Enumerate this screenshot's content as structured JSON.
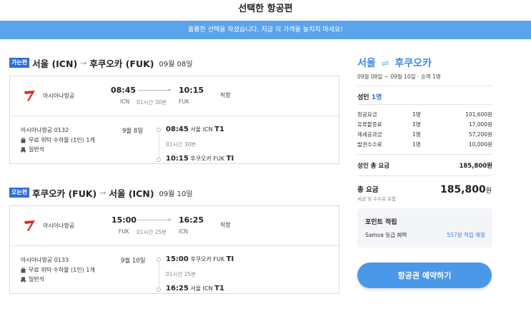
{
  "page_title": "선택한 항공편",
  "banner": "훌륭한 선택을 하셨습니다. 지금 이 가격을 놓치지 마세요!",
  "outbound": {
    "badge": "가는편",
    "from": "서울 (ICN)",
    "arrow": "→",
    "to": "후쿠오카 (FUK)",
    "date": "09월 08일",
    "airline": "아시아나항공",
    "dep_time": "08:45",
    "dep_code": "ICN",
    "arr_time": "10:15",
    "arr_code": "FUK",
    "duration": "01시간 30분",
    "stops": "직항",
    "flight_no": "아시아나항공 0132",
    "baggage": "무료 위탁 수하물 (1인) 1개",
    "cabin": "일반석",
    "day": "9월 8일",
    "dep_detail_time": "08:45",
    "dep_detail_place": "서울 ICN",
    "dep_terminal": "T1",
    "detail_duration": "01시간 30분",
    "arr_detail_time": "10:15",
    "arr_detail_place": "후쿠오카 FUK",
    "arr_terminal": "TI"
  },
  "inbound": {
    "badge": "오는편",
    "from": "후쿠오카 (FUK)",
    "arrow": "→",
    "to": "서울 (ICN)",
    "date": "09월 10일",
    "airline": "아시아나항공",
    "dep_time": "15:00",
    "dep_code": "FUK",
    "arr_time": "16:25",
    "arr_code": "ICN",
    "duration": "01시간 25분",
    "stops": "직항",
    "flight_no": "아시아나항공 0133",
    "baggage": "무료 위탁 수하물 (1인) 1개",
    "cabin": "일반석",
    "day": "9월 10일",
    "dep_detail_time": "15:00",
    "dep_detail_place": "후쿠오카 FUK",
    "dep_terminal": "TI",
    "detail_duration": "01시간 25분",
    "arr_detail_time": "16:25",
    "arr_detail_place": "서울 ICN",
    "arr_terminal": "T1"
  },
  "summary": {
    "from": "서울",
    "swap": "⇌",
    "to": "후쿠오카",
    "meta": "09월 08일 ~ 09월 10일 · 승객 1명",
    "adult_label": "성인",
    "adult_count": "1명",
    "fees": [
      {
        "name": "항공요금",
        "qty": "1명",
        "value": "101,600원"
      },
      {
        "name": "유류할증료",
        "qty": "1명",
        "value": "17,000원"
      },
      {
        "name": "제세공과금",
        "qty": "1명",
        "value": "57,200원"
      },
      {
        "name": "발권수수료",
        "qty": "1명",
        "value": "10,000원"
      }
    ],
    "subtotal_label": "성인 총 요금",
    "subtotal_value": "185,800원",
    "total_label": "총 요금",
    "total_note": "세금 및 수수료 포함",
    "total_value": "185,800",
    "total_unit": "원",
    "points_title": "포인트 적립",
    "points_label": "Samoa 등급 혜택",
    "points_value": "557원 적립 예정",
    "book_button": "항공권 예약하기"
  },
  "colors": {
    "banner": "#5ba4ec",
    "accent": "#3b8ae6",
    "badge": "#2f6fd6",
    "button": "#4a98ea",
    "airline_logo": "#d92b2b"
  }
}
